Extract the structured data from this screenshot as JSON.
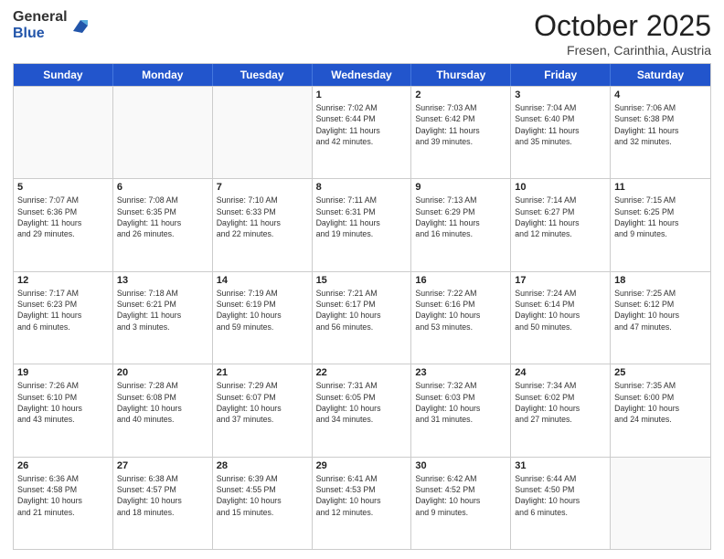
{
  "header": {
    "logo_general": "General",
    "logo_blue": "Blue",
    "month_title": "October 2025",
    "location": "Fresen, Carinthia, Austria"
  },
  "days": [
    "Sunday",
    "Monday",
    "Tuesday",
    "Wednesday",
    "Thursday",
    "Friday",
    "Saturday"
  ],
  "rows": [
    [
      {
        "date": "",
        "info": ""
      },
      {
        "date": "",
        "info": ""
      },
      {
        "date": "",
        "info": ""
      },
      {
        "date": "1",
        "info": "Sunrise: 7:02 AM\nSunset: 6:44 PM\nDaylight: 11 hours\nand 42 minutes."
      },
      {
        "date": "2",
        "info": "Sunrise: 7:03 AM\nSunset: 6:42 PM\nDaylight: 11 hours\nand 39 minutes."
      },
      {
        "date": "3",
        "info": "Sunrise: 7:04 AM\nSunset: 6:40 PM\nDaylight: 11 hours\nand 35 minutes."
      },
      {
        "date": "4",
        "info": "Sunrise: 7:06 AM\nSunset: 6:38 PM\nDaylight: 11 hours\nand 32 minutes."
      }
    ],
    [
      {
        "date": "5",
        "info": "Sunrise: 7:07 AM\nSunset: 6:36 PM\nDaylight: 11 hours\nand 29 minutes."
      },
      {
        "date": "6",
        "info": "Sunrise: 7:08 AM\nSunset: 6:35 PM\nDaylight: 11 hours\nand 26 minutes."
      },
      {
        "date": "7",
        "info": "Sunrise: 7:10 AM\nSunset: 6:33 PM\nDaylight: 11 hours\nand 22 minutes."
      },
      {
        "date": "8",
        "info": "Sunrise: 7:11 AM\nSunset: 6:31 PM\nDaylight: 11 hours\nand 19 minutes."
      },
      {
        "date": "9",
        "info": "Sunrise: 7:13 AM\nSunset: 6:29 PM\nDaylight: 11 hours\nand 16 minutes."
      },
      {
        "date": "10",
        "info": "Sunrise: 7:14 AM\nSunset: 6:27 PM\nDaylight: 11 hours\nand 12 minutes."
      },
      {
        "date": "11",
        "info": "Sunrise: 7:15 AM\nSunset: 6:25 PM\nDaylight: 11 hours\nand 9 minutes."
      }
    ],
    [
      {
        "date": "12",
        "info": "Sunrise: 7:17 AM\nSunset: 6:23 PM\nDaylight: 11 hours\nand 6 minutes."
      },
      {
        "date": "13",
        "info": "Sunrise: 7:18 AM\nSunset: 6:21 PM\nDaylight: 11 hours\nand 3 minutes."
      },
      {
        "date": "14",
        "info": "Sunrise: 7:19 AM\nSunset: 6:19 PM\nDaylight: 10 hours\nand 59 minutes."
      },
      {
        "date": "15",
        "info": "Sunrise: 7:21 AM\nSunset: 6:17 PM\nDaylight: 10 hours\nand 56 minutes."
      },
      {
        "date": "16",
        "info": "Sunrise: 7:22 AM\nSunset: 6:16 PM\nDaylight: 10 hours\nand 53 minutes."
      },
      {
        "date": "17",
        "info": "Sunrise: 7:24 AM\nSunset: 6:14 PM\nDaylight: 10 hours\nand 50 minutes."
      },
      {
        "date": "18",
        "info": "Sunrise: 7:25 AM\nSunset: 6:12 PM\nDaylight: 10 hours\nand 47 minutes."
      }
    ],
    [
      {
        "date": "19",
        "info": "Sunrise: 7:26 AM\nSunset: 6:10 PM\nDaylight: 10 hours\nand 43 minutes."
      },
      {
        "date": "20",
        "info": "Sunrise: 7:28 AM\nSunset: 6:08 PM\nDaylight: 10 hours\nand 40 minutes."
      },
      {
        "date": "21",
        "info": "Sunrise: 7:29 AM\nSunset: 6:07 PM\nDaylight: 10 hours\nand 37 minutes."
      },
      {
        "date": "22",
        "info": "Sunrise: 7:31 AM\nSunset: 6:05 PM\nDaylight: 10 hours\nand 34 minutes."
      },
      {
        "date": "23",
        "info": "Sunrise: 7:32 AM\nSunset: 6:03 PM\nDaylight: 10 hours\nand 31 minutes."
      },
      {
        "date": "24",
        "info": "Sunrise: 7:34 AM\nSunset: 6:02 PM\nDaylight: 10 hours\nand 27 minutes."
      },
      {
        "date": "25",
        "info": "Sunrise: 7:35 AM\nSunset: 6:00 PM\nDaylight: 10 hours\nand 24 minutes."
      }
    ],
    [
      {
        "date": "26",
        "info": "Sunrise: 6:36 AM\nSunset: 4:58 PM\nDaylight: 10 hours\nand 21 minutes."
      },
      {
        "date": "27",
        "info": "Sunrise: 6:38 AM\nSunset: 4:57 PM\nDaylight: 10 hours\nand 18 minutes."
      },
      {
        "date": "28",
        "info": "Sunrise: 6:39 AM\nSunset: 4:55 PM\nDaylight: 10 hours\nand 15 minutes."
      },
      {
        "date": "29",
        "info": "Sunrise: 6:41 AM\nSunset: 4:53 PM\nDaylight: 10 hours\nand 12 minutes."
      },
      {
        "date": "30",
        "info": "Sunrise: 6:42 AM\nSunset: 4:52 PM\nDaylight: 10 hours\nand 9 minutes."
      },
      {
        "date": "31",
        "info": "Sunrise: 6:44 AM\nSunset: 4:50 PM\nDaylight: 10 hours\nand 6 minutes."
      },
      {
        "date": "",
        "info": ""
      }
    ]
  ]
}
